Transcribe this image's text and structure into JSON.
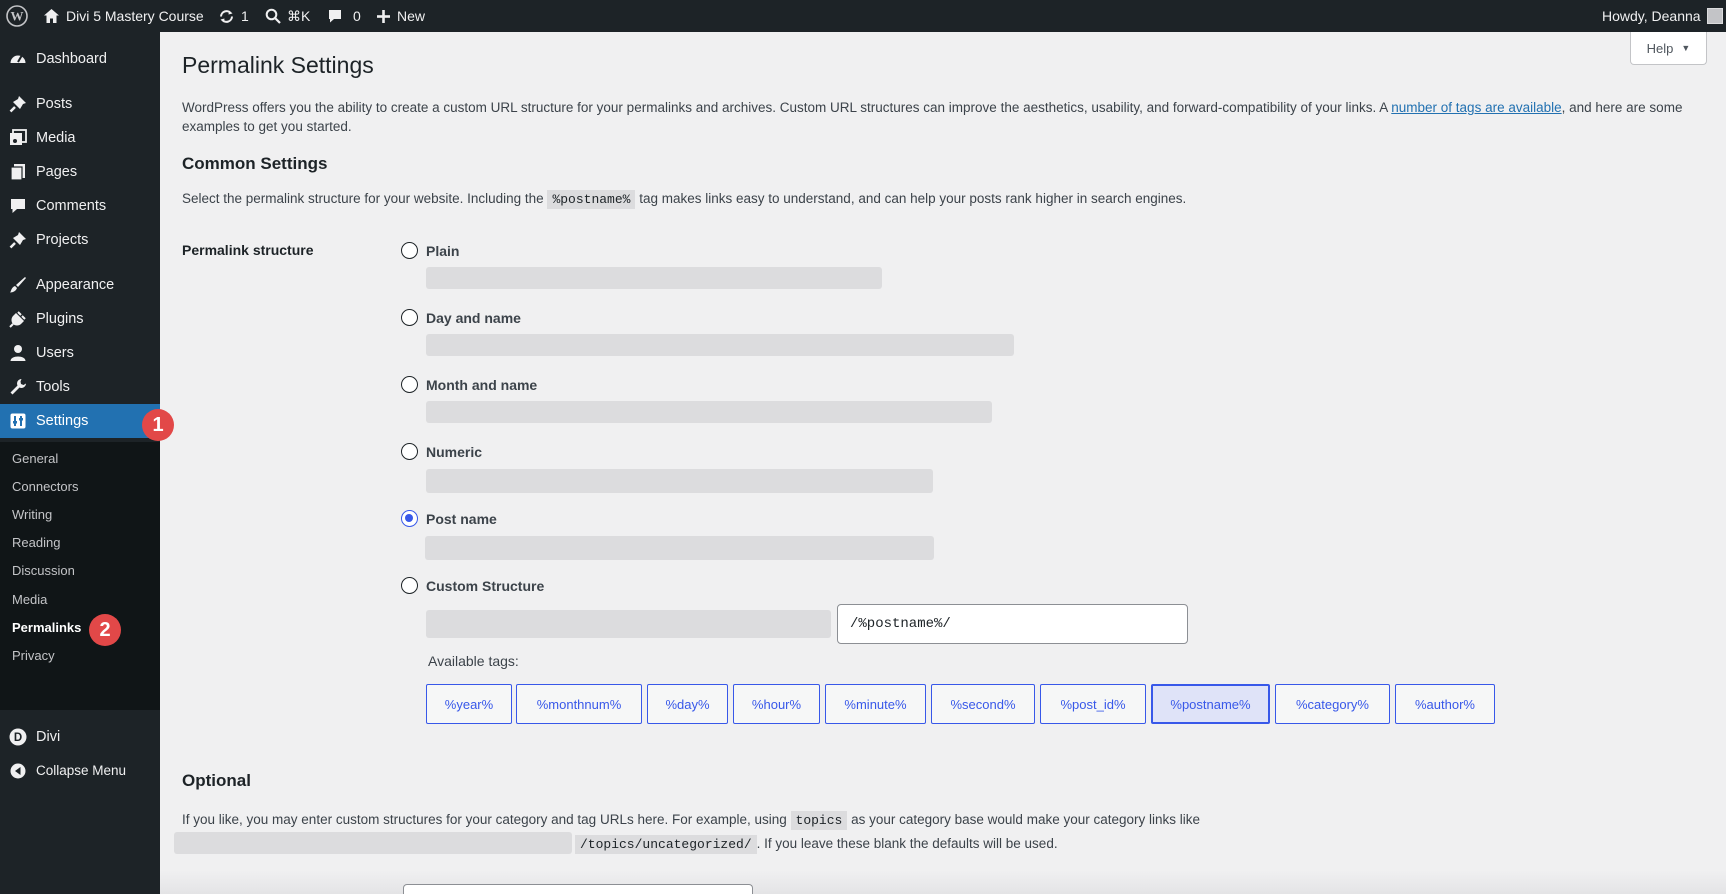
{
  "admin_bar": {
    "site_name": "Divi 5 Mastery Course",
    "updates_count": "1",
    "search_shortcut": "⌘K",
    "comments_count": "0",
    "new_label": "New",
    "greeting": "Howdy, Deanna"
  },
  "sidebar": {
    "dashboard": "Dashboard",
    "posts": "Posts",
    "media": "Media",
    "pages": "Pages",
    "comments": "Comments",
    "projects": "Projects",
    "appearance": "Appearance",
    "plugins": "Plugins",
    "users": "Users",
    "tools": "Tools",
    "settings": "Settings",
    "divi": "Divi",
    "collapse": "Collapse Menu",
    "submenu": {
      "general": "General",
      "connectors": "Connectors",
      "writing": "Writing",
      "reading": "Reading",
      "discussion": "Discussion",
      "media": "Media",
      "permalinks": "Permalinks",
      "privacy": "Privacy"
    },
    "badges": {
      "settings": "1",
      "permalinks": "2"
    }
  },
  "help": {
    "label": "Help"
  },
  "page": {
    "title": "Permalink Settings",
    "intro_before_link": "WordPress offers you the ability to create a custom URL structure for your permalinks and archives. Custom URL structures can improve the aesthetics, usability, and forward-compatibility of your links. A ",
    "intro_link": "number of tags are available",
    "intro_after_link": ", and here are some examples to get you started.",
    "common_heading": "Common Settings",
    "common_desc_before": "Select the permalink structure for your website. Including the ",
    "common_desc_code": "%postname%",
    "common_desc_after": " tag makes links easy to understand, and can help your posts rank higher in search engines.",
    "structure_label": "Permalink structure",
    "options": {
      "plain": "Plain",
      "day_name": "Day and name",
      "month_name": "Month and name",
      "numeric": "Numeric",
      "post_name": "Post name",
      "custom": "Custom Structure"
    },
    "selected_option": "Post name",
    "custom_value": "/%postname%/",
    "available_tags_label": "Available tags:",
    "tags": {
      "year": "%year%",
      "monthnum": "%monthnum%",
      "day": "%day%",
      "hour": "%hour%",
      "minute": "%minute%",
      "second": "%second%",
      "post_id": "%post_id%",
      "postname": "%postname%",
      "category": "%category%",
      "author": "%author%"
    },
    "optional_heading": "Optional",
    "optional_desc_before": "If you like, you may enter custom structures for your category and tag URLs here. For example, using ",
    "optional_desc_code": "topics",
    "optional_desc_after": " as your category base would make your category links like",
    "optional_example_code": "/topics/uncategorized/",
    "optional_desc_end": ". If you leave these blank the defaults will be used."
  },
  "colors": {
    "admin_bar": "#1d2327",
    "active_menu": "#2271b1",
    "accent": "#3858e9",
    "badge": "#e24848"
  }
}
